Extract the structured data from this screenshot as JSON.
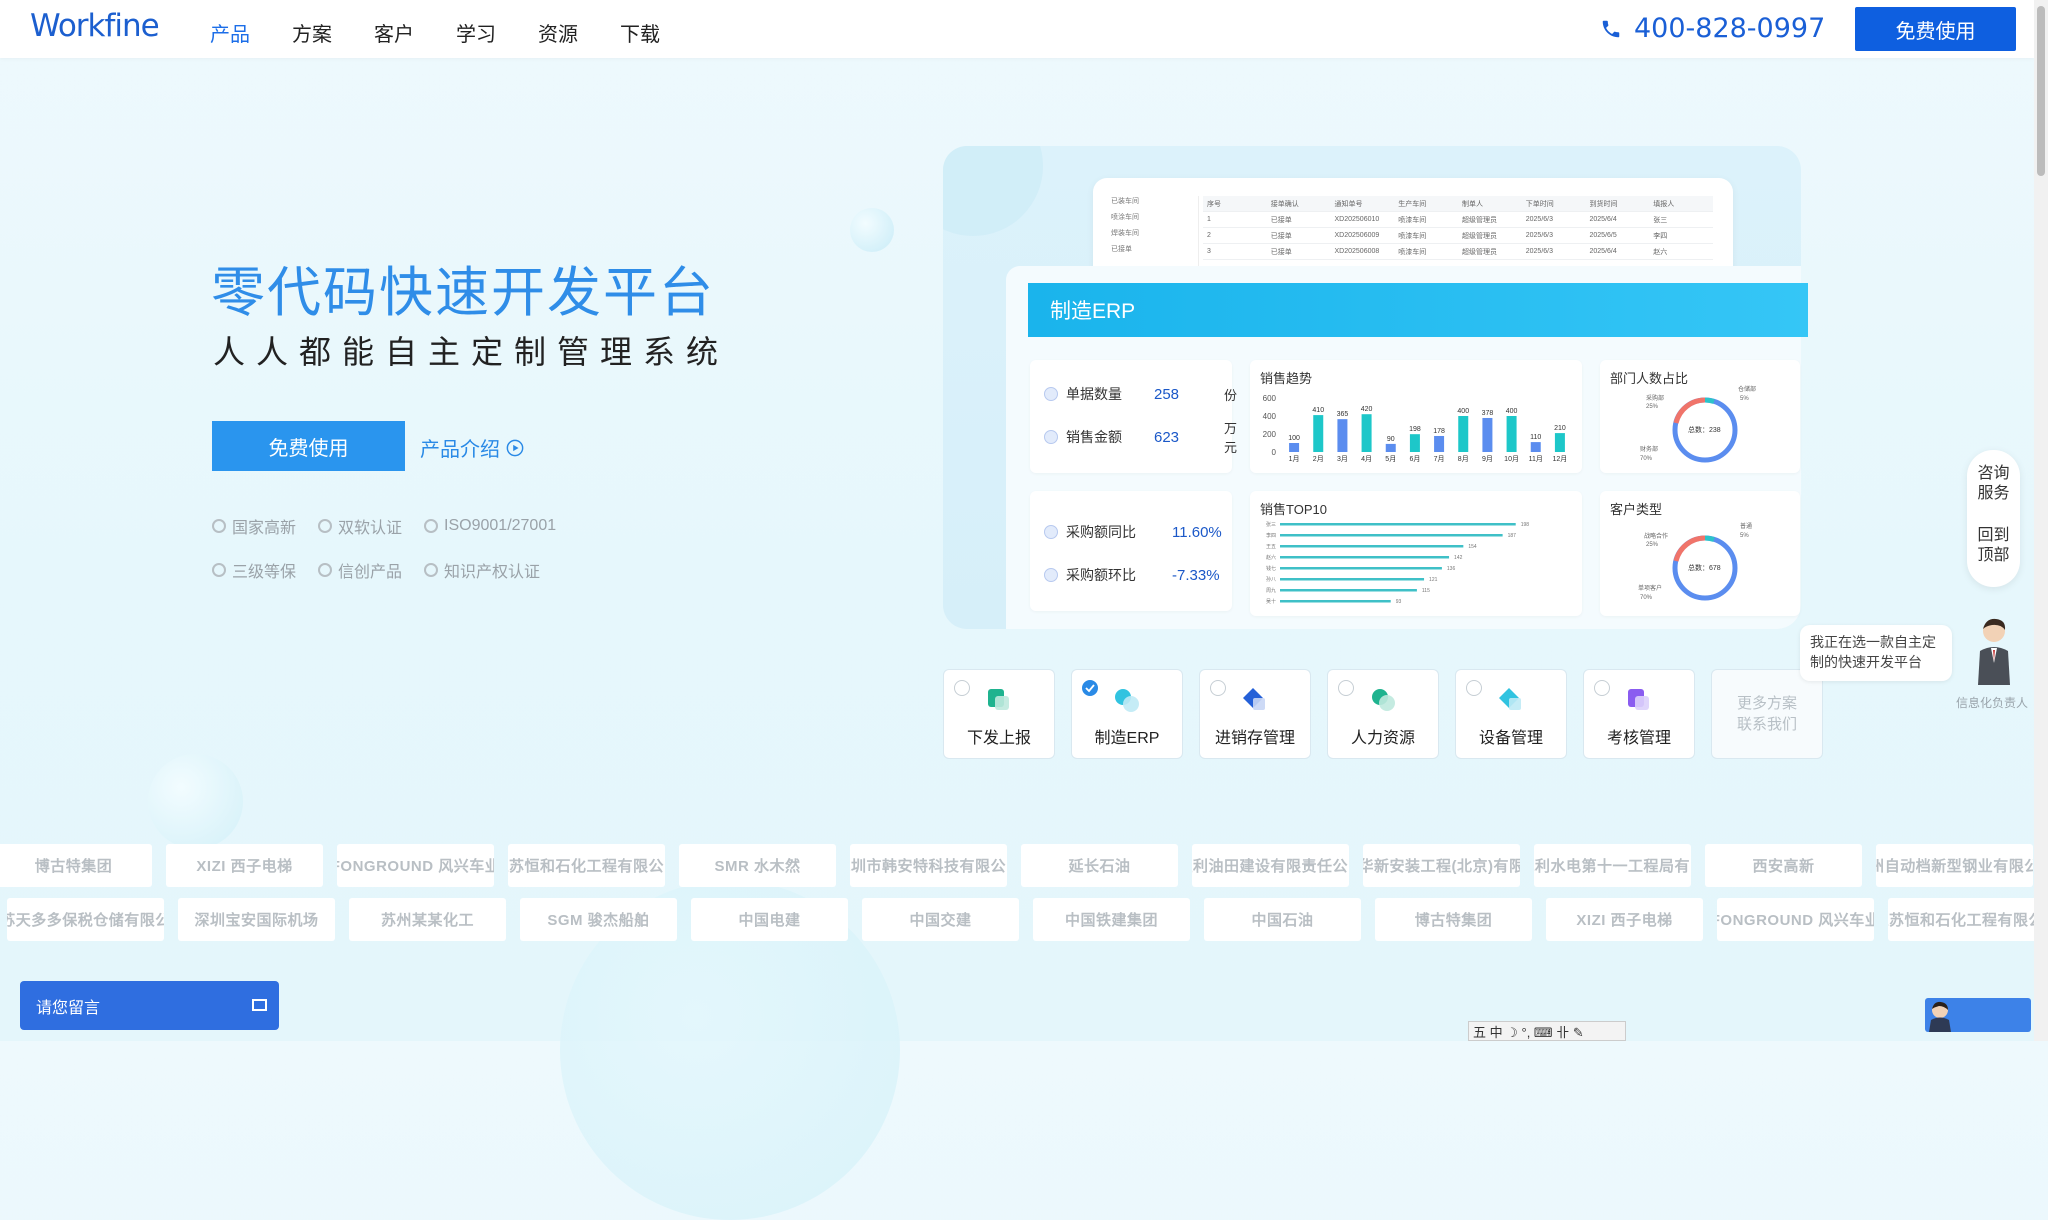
{
  "nav": {
    "logo": "Workfine",
    "menu": [
      "产品",
      "方案",
      "客户",
      "学习",
      "资源",
      "下载"
    ],
    "active_index": 0,
    "phone": "400-828-0997",
    "cta": "免费使用"
  },
  "hero": {
    "title": "零代码快速开发平台",
    "subtitle": "人人都能自主定制管理系统",
    "primary_button": "免费使用",
    "link_button": "产品介绍",
    "certs": [
      "国家高新",
      "双软认证",
      "ISO9001/27001",
      "三级等保",
      "信创产品",
      "知识产权认证"
    ]
  },
  "mock": {
    "back_table": {
      "side_items": [
        "已装车间",
        "喷涂车间",
        "焊装车间",
        "已接单"
      ],
      "headers": [
        "序号",
        "接单确认",
        "通知单号",
        "生产车间",
        "制单人",
        "下单时间",
        "到货时间",
        "填报人"
      ],
      "rows": [
        [
          "1",
          "已接单",
          "XD202506010",
          "喷漆车间",
          "超级管理员",
          "2025/6/3",
          "2025/6/4",
          "张三"
        ],
        [
          "2",
          "已接单",
          "XD202506009",
          "喷漆车间",
          "超级管理员",
          "2025/6/3",
          "2025/6/5",
          "李四"
        ],
        [
          "3",
          "已接单",
          "XD202506008",
          "喷漆车间",
          "超级管理员",
          "2025/6/3",
          "2025/6/4",
          "赵六"
        ]
      ]
    },
    "banner": "制造ERP",
    "stats": [
      {
        "label": "单据数量",
        "value": "258",
        "unit": "份"
      },
      {
        "label": "销售金额",
        "value": "623",
        "unit": "万元"
      }
    ],
    "compare": [
      {
        "label": "采购额同比",
        "value": "11.60%"
      },
      {
        "label": "采购额环比",
        "value": "-7.33%"
      }
    ],
    "trend_title": "销售趋势",
    "top10_title": "销售TOP10",
    "dept_title": "部门人数占比",
    "dept_center": "总数：238",
    "dept_labels": [
      "采购部",
      "25%",
      "仓储部",
      "5%",
      "财务部",
      "70%"
    ],
    "cust_title": "客户类型",
    "cust_center": "总数：678",
    "cust_labels": [
      "战略合作",
      "25%",
      "普通",
      "5%",
      "单项客户",
      "70%"
    ],
    "top10_labels": [
      "张三",
      "李四",
      "王五",
      "赵六",
      "钱七",
      "孙八",
      "周九",
      "吴十",
      "郑一",
      "冯二"
    ]
  },
  "chart_data": [
    {
      "type": "bar",
      "title": "销售趋势",
      "categories": [
        "1月",
        "2月",
        "3月",
        "4月",
        "5月",
        "6月",
        "7月",
        "8月",
        "9月",
        "10月",
        "11月",
        "12月"
      ],
      "values": [
        100,
        410,
        365,
        420,
        90,
        198,
        178,
        400,
        378,
        400,
        110,
        210
      ],
      "ylim": [
        0,
        600
      ],
      "yticks": [
        0,
        200,
        400,
        600
      ]
    },
    {
      "type": "bar",
      "title": "销售TOP10",
      "orientation": "horizontal",
      "values": [
        198,
        187,
        154,
        142,
        136,
        121,
        115,
        93
      ]
    }
  ],
  "tabs": [
    {
      "label": "下发上报",
      "selected": false,
      "color": "#1fb38f"
    },
    {
      "label": "制造ERP",
      "selected": true,
      "color": "#31c3e0"
    },
    {
      "label": "进销存管理",
      "selected": false,
      "color": "#2460d8"
    },
    {
      "label": "人力资源",
      "selected": false,
      "color": "#1fb38f"
    },
    {
      "label": "设备管理",
      "selected": false,
      "color": "#31c3e0"
    },
    {
      "label": "考核管理",
      "selected": false,
      "color": "#8a5cf0"
    }
  ],
  "tabs_more": "更多方案\n联系我们",
  "float_side": {
    "consult": "咨询服务",
    "top": "回到顶部"
  },
  "chat_tip": "我正在选一款自主定制的快速开发平台",
  "chat_caption": "信息化负责人",
  "logos_row1": [
    "博古特集团",
    "XIZI 西子电梯",
    "FONGROUND 风兴车业",
    "江苏恒和石化工程有限公司",
    "SMR 水木然",
    "深圳市韩安特科技有限公司",
    "延长石油",
    "胜利油田建设有限责任公司",
    "中航华新安装工程(北京)有限公司",
    "中国水利水电第十一工程局有限公司",
    "西安高新",
    "广州自动档新型钢业有限公司"
  ],
  "logos_row2": [
    "江苏天多多保税仓储有限公司",
    "深圳宝安国际机场",
    "苏州某某化工",
    "SGM 骏杰船舶",
    "中国电建",
    "中国交建",
    "中国铁建集团",
    "中国石油",
    "博古特集团",
    "XIZI 西子电梯",
    "FONGROUND 风兴车业",
    "江苏恒和石化工程有限公司"
  ],
  "message_button": "请您留言",
  "ime": "五 中 ☽ °, ⌨ 卝 ✎",
  "brand_colors": {
    "primary": "#0e5fe0",
    "accent": "#2a95ee",
    "teal": "#1dc7c9"
  }
}
